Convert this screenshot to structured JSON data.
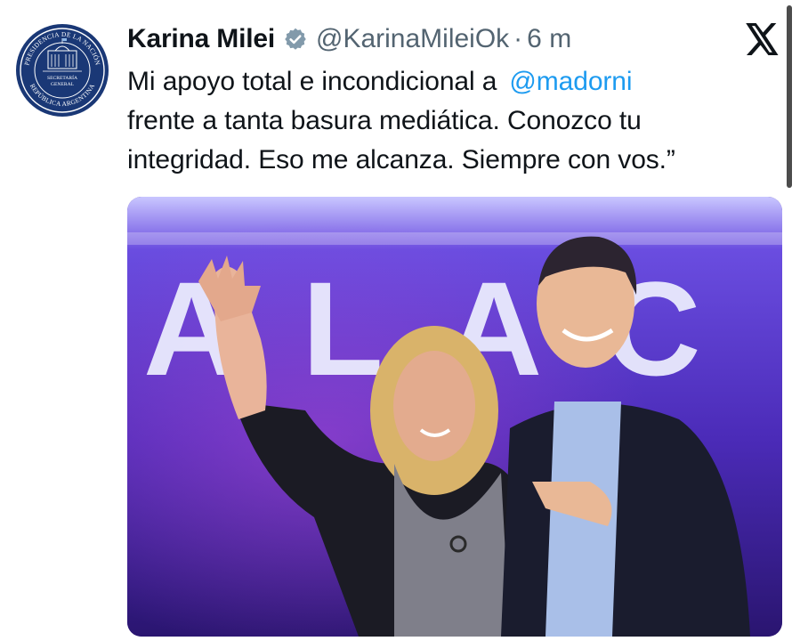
{
  "tweet": {
    "author_name": "Karina Milei",
    "handle": "@KarinaMileiOk",
    "separator": "·",
    "time": "6 m",
    "text_line1_prefix": "Mi apoyo total e incondicional a",
    "mention": "@madorni",
    "text_line2": "frente a tanta basura mediática. Conozco tu",
    "text_line3": "integridad. Eso me alcanza. Siempre con vos.”"
  },
  "avatar": {
    "arc_top": "PRESIDENCIA DE LA NACIÓN",
    "arc_bottom": "REPÚBLICA ARGENTINA",
    "center_line1": "SECRETARÍA",
    "center_line2": "GENERAL"
  },
  "photo": {
    "background_letters": "ALAC"
  },
  "icons": {
    "verified": "verified-badge-icon",
    "platform": "x-logo-icon"
  },
  "colors": {
    "mention": "#1d9bf0",
    "secondary_text": "#536471",
    "avatar_blue": "#1a3876",
    "stage_purple": "#4b2bb8"
  }
}
